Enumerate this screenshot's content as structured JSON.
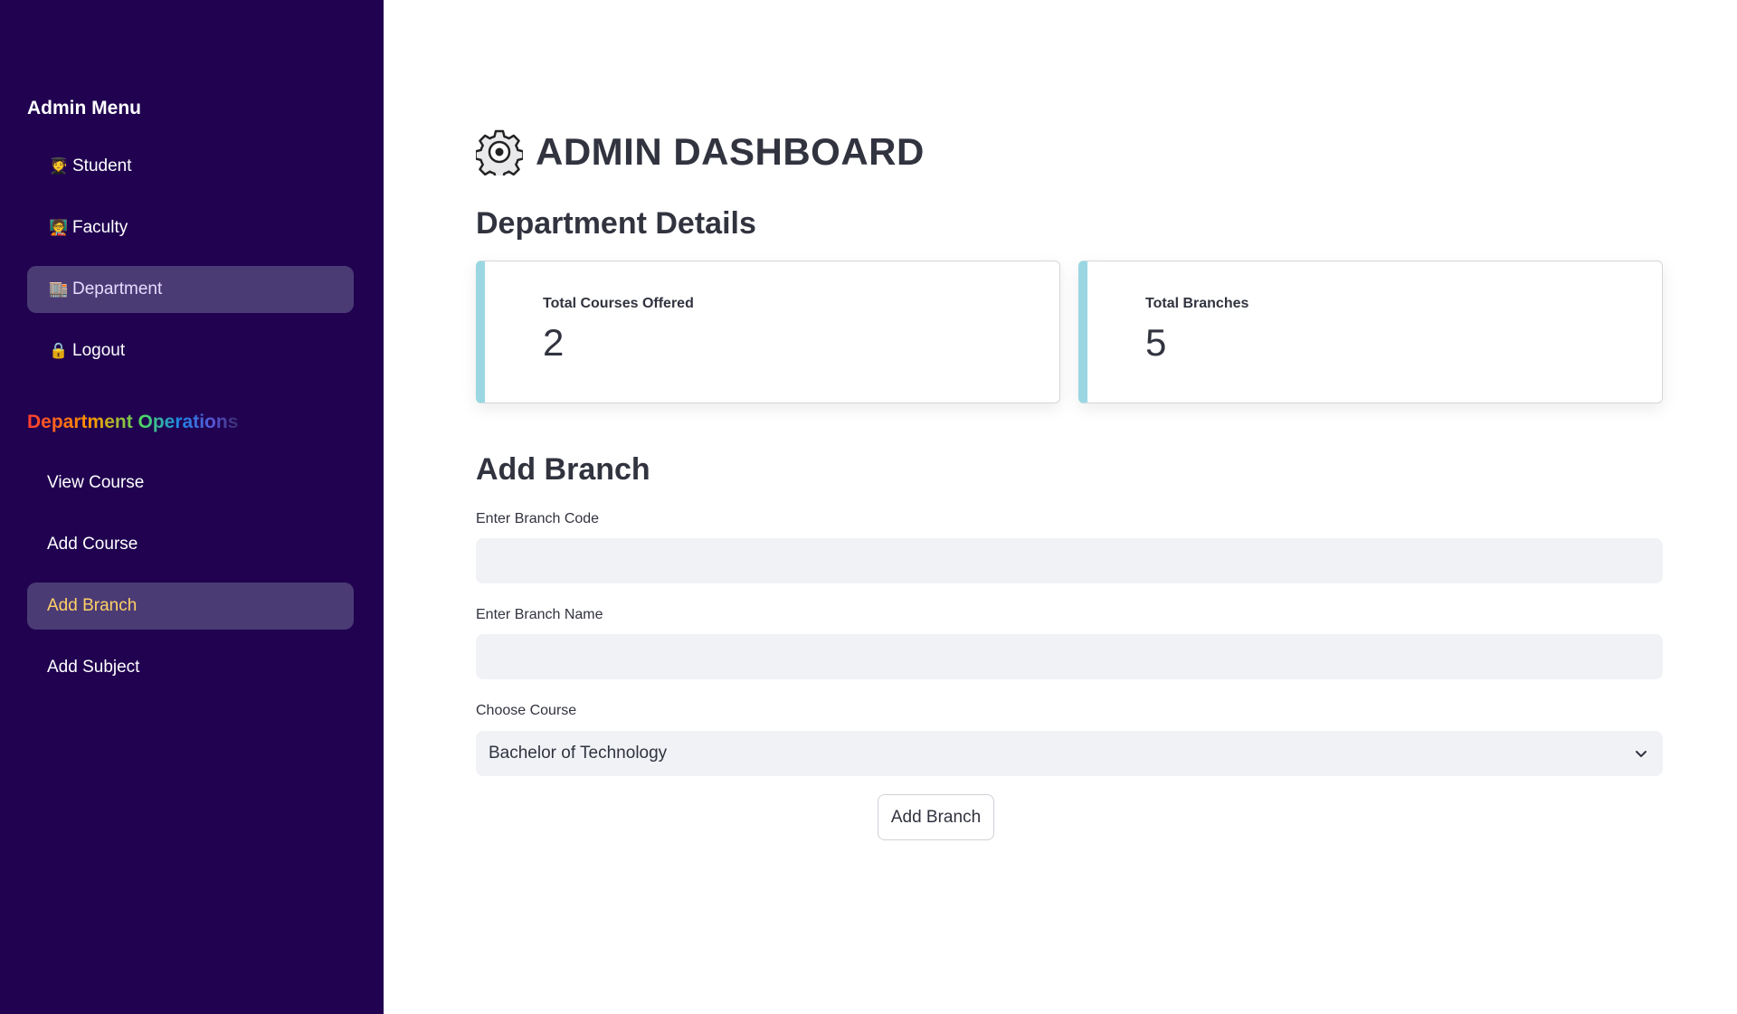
{
  "sidebar": {
    "menu_heading": "Admin Menu",
    "menu_items": [
      {
        "emoji": "🧑‍🎓",
        "label": "Student",
        "active": false
      },
      {
        "emoji": "🧑‍🏫",
        "label": "Faculty",
        "active": false
      },
      {
        "emoji": "🏬",
        "label": "Department",
        "active": true
      },
      {
        "emoji": "🔒",
        "label": "Logout",
        "active": false
      }
    ],
    "ops_heading": "Department Operations",
    "ops_items": [
      {
        "label": "View Course",
        "active": false
      },
      {
        "label": "Add Course",
        "active": false
      },
      {
        "label": "Add Branch",
        "active": true
      },
      {
        "label": "Add Subject",
        "active": false
      }
    ]
  },
  "main": {
    "title": "ADMIN DASHBOARD",
    "details_heading": "Department Details",
    "metrics": [
      {
        "label": "Total Courses Offered",
        "value": "2"
      },
      {
        "label": "Total Branches",
        "value": "5"
      }
    ],
    "form": {
      "heading": "Add Branch",
      "branch_code_label": "Enter Branch Code",
      "branch_code_value": "",
      "branch_name_label": "Enter Branch Name",
      "branch_name_value": "",
      "course_label": "Choose Course",
      "course_selected": "Bachelor of Technology",
      "submit_label": "Add Branch"
    }
  },
  "colors": {
    "sidebar_bg": "#200250",
    "active_item_bg": "#4b3b75",
    "metric_accent": "#9ad7e2",
    "input_bg": "#f0f2f6",
    "active_ops_text": "#ffd166"
  }
}
